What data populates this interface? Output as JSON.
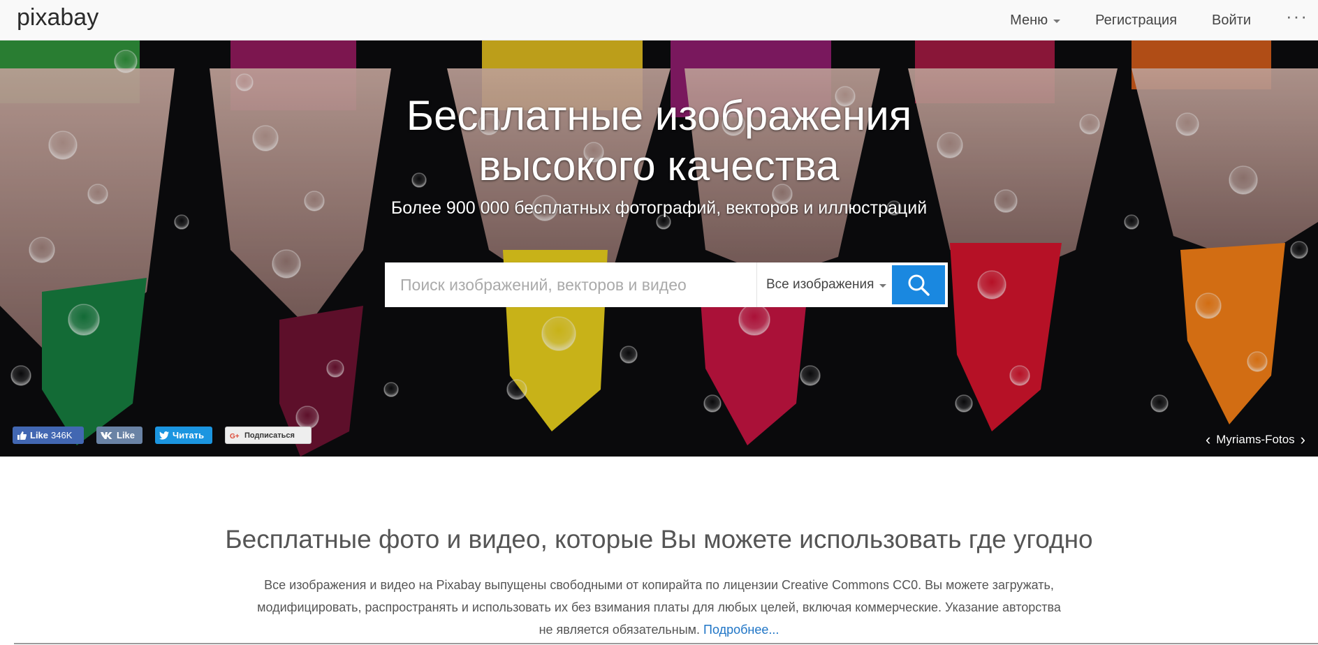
{
  "header": {
    "logo_text": "pixabay",
    "nav": {
      "menu": "Меню",
      "register": "Регистрация",
      "login": "Войти",
      "more": "···"
    }
  },
  "hero": {
    "title_line1": "Бесплатные изображения",
    "title_line2": "высокого качества",
    "subtitle": "Более 900 000 бесплатных фотографий, векторов и иллюстраций",
    "search": {
      "placeholder": "Поиск изображений, векторов и видео",
      "type_selected": "Все изображения"
    },
    "social": {
      "facebook_label": "Like",
      "facebook_count": "346K",
      "vk_label": "Like",
      "twitter_label": "Читать",
      "google_label": "Подписаться"
    },
    "credit": {
      "author": "Myriams-Fotos",
      "prev": "‹",
      "next": "›"
    }
  },
  "content": {
    "title": "Бесплатные фото и видео, которые Вы можете использовать где угодно",
    "text_line1": "Все изображения и видео на Pixabay выпущены свободными от копирайта по лицензии Creative Commons CC0. Вы можете загружать,",
    "text_line2": "модифицировать, распространять и использовать их без взимания платы для любых целей, включая коммерческие. Указание авторства",
    "text_line3": "не является обязательным.",
    "link": "Подробнее..."
  },
  "colors": {
    "accent": "#1a88e0",
    "link": "#1f75c6",
    "facebook": "#4267b2",
    "vk": "#6a83a5",
    "twitter": "#1b95e0"
  }
}
